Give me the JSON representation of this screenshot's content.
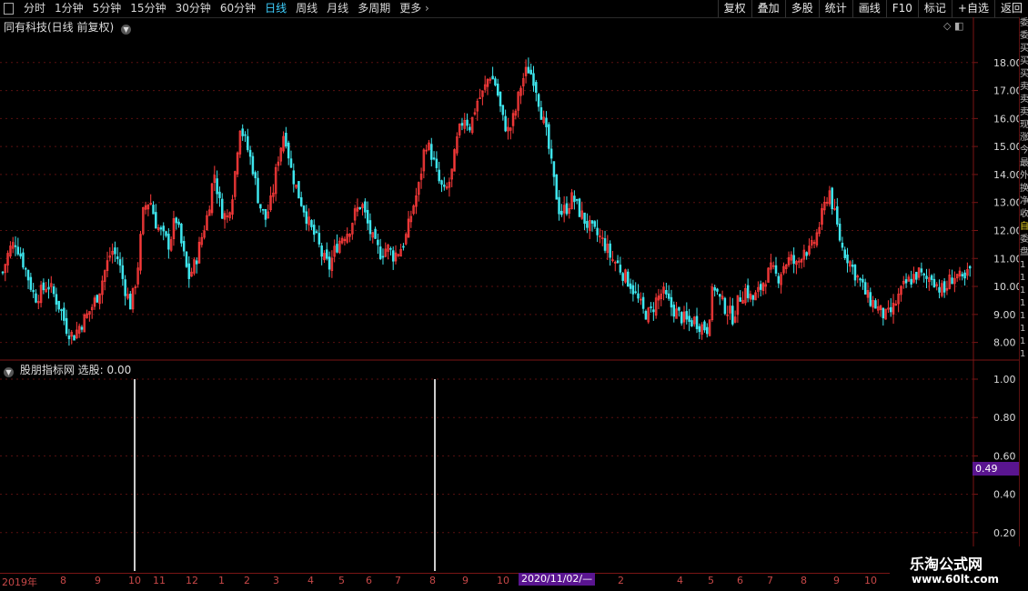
{
  "toolbar": {
    "periods": [
      "分时",
      "1分钟",
      "5分钟",
      "15分钟",
      "30分钟",
      "60分钟",
      "日线",
      "周线",
      "月线",
      "多周期",
      "更多"
    ],
    "active_period": "日线",
    "actions": [
      "复权",
      "叠加",
      "多股",
      "统计",
      "画线",
      "F10",
      "标记",
      "+自选",
      "返回"
    ]
  },
  "main_chart": {
    "title": "同有科技(日线 前复权)",
    "price_ticks": [
      "18.00",
      "17.00",
      "16.00",
      "15.00",
      "14.00",
      "13.00",
      "12.00",
      "11.00",
      "10.00",
      "9.00",
      "8.00"
    ]
  },
  "indicator": {
    "title": "股朋指标网 选股: 0.00",
    "ticks": [
      "1.00",
      "0.80",
      "0.60",
      "0.40",
      "0.20"
    ],
    "cursor_value": "0.49"
  },
  "date_axis": {
    "labels": [
      "2019年",
      "8",
      "9",
      "10",
      "11",
      "12",
      "1",
      "2",
      "3",
      "4",
      "5",
      "6",
      "7",
      "8",
      "9",
      "10",
      "2",
      "4",
      "5",
      "6",
      "7",
      "8",
      "9",
      "10"
    ],
    "cursor": "2020/11/02/—"
  },
  "watermark": {
    "line1": "乐淘公式网",
    "line2": "www.60lt.com"
  },
  "right_strip": [
    "委",
    "委",
    "买",
    "买",
    "买",
    "卖",
    "卖",
    "卖",
    "现",
    "涨",
    "今",
    "最",
    "外",
    "换",
    "净",
    "收",
    "自",
    "委",
    "盘",
    "1",
    "1",
    "1",
    "1",
    "1",
    "1",
    "1",
    "1"
  ],
  "colors": {
    "up": "#ff3b3b",
    "down": "#3ee6ee",
    "grid": "#5a1010",
    "accent": "#3ed0ff",
    "cursor_bg": "#5a1590"
  },
  "chart_data": {
    "type": "candlestick",
    "title": "同有科技(日线 前复权)",
    "ylim": [
      7.5,
      19.0
    ],
    "close_path": [
      10.5,
      11.3,
      11.6,
      11.0,
      10.3,
      9.6,
      9.8,
      10.1,
      9.7,
      9.2,
      8.5,
      8.2,
      8.6,
      8.9,
      9.3,
      9.8,
      10.6,
      11.3,
      11.0,
      10.0,
      9.3,
      10.5,
      12.8,
      13.1,
      12.2,
      11.8,
      11.5,
      12.5,
      11.4,
      10.3,
      10.8,
      11.7,
      12.6,
      14.1,
      12.8,
      12.4,
      13.5,
      15.8,
      15.1,
      14.3,
      13.0,
      12.4,
      13.1,
      14.6,
      15.6,
      14.2,
      13.4,
      12.8,
      12.1,
      11.7,
      11.0,
      10.7,
      11.4,
      11.8,
      12.0,
      12.6,
      13.0,
      12.2,
      11.5,
      11.2,
      11.4,
      11.1,
      11.3,
      11.8,
      12.8,
      13.6,
      15.2,
      14.7,
      13.8,
      13.3,
      13.9,
      15.3,
      16.1,
      15.7,
      16.6,
      16.9,
      17.6,
      17.2,
      16.0,
      15.5,
      16.2,
      17.3,
      17.8,
      17.4,
      16.3,
      15.3,
      13.8,
      12.6,
      12.8,
      13.2,
      12.7,
      12.3,
      12.0,
      11.8,
      11.5,
      11.0,
      10.8,
      10.4,
      10.1,
      9.6,
      9.1,
      9.0,
      9.5,
      9.8,
      9.4,
      9.1,
      8.9,
      8.7,
      8.8,
      8.6,
      8.5,
      10.1,
      9.5,
      9.2,
      8.9,
      9.6,
      9.9,
      9.5,
      9.8,
      10.3,
      10.6,
      10.3,
      10.8,
      11.0,
      10.7,
      11.4,
      11.2,
      11.8,
      12.6,
      13.5,
      12.4,
      11.4,
      11.0,
      10.5,
      10.1,
      9.6,
      9.4,
      9.1,
      8.9,
      9.2,
      9.7,
      10.1,
      10.3,
      10.5,
      10.2,
      10.4,
      10.0,
      9.8,
      10.3,
      10.4,
      10.1,
      10.6
    ]
  }
}
